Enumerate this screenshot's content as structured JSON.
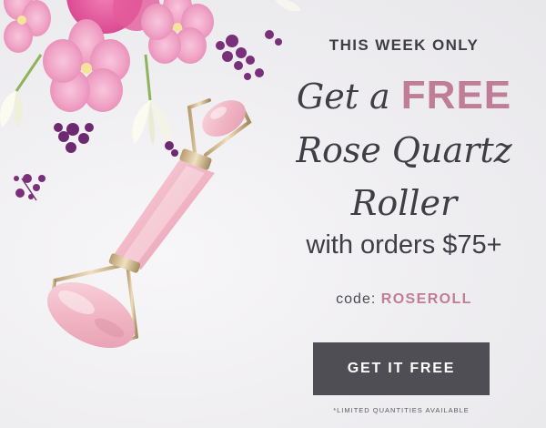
{
  "promo": {
    "eyebrow": "THIS WEEK ONLY",
    "headline": {
      "line1_prefix": "Get a",
      "line1_highlight": "FREE",
      "line2": "Rose Quartz",
      "line3": "Roller"
    },
    "subline": "with orders $75+",
    "code": {
      "label": "code:",
      "value": "ROSEROLL"
    },
    "cta_label": "GET IT FREE",
    "fine_print": "*LIMITED QUANTITIES AVAILABLE"
  },
  "colors": {
    "accent_pink": "#c07d96",
    "text_dark": "#3e3e44",
    "button_bg": "#4f4e54",
    "background": "#efeef1"
  },
  "icons": {
    "hero_image": "rose-quartz-roller-with-flowers"
  }
}
